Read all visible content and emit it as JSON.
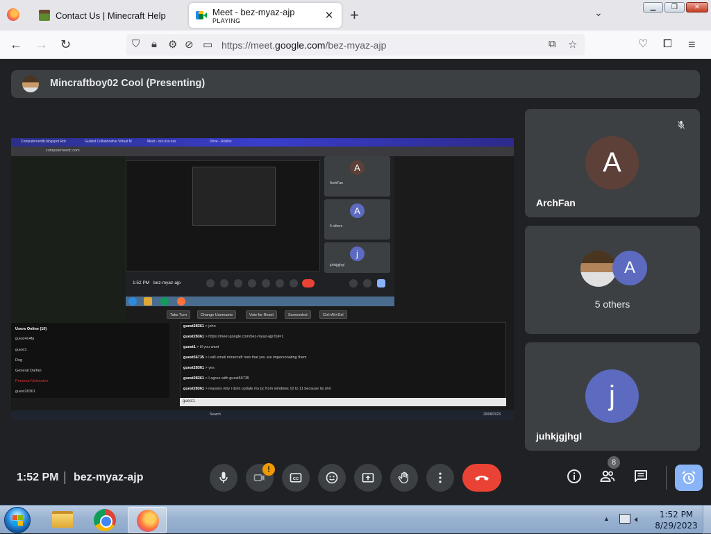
{
  "browser": {
    "tabs": [
      {
        "title": "Contact Us | Minecraft Help",
        "subtitle": ""
      },
      {
        "title": "Meet - bez-myaz-ajp",
        "subtitle": "PLAYING"
      }
    ],
    "new_tab": "+",
    "url_prefix": "https://meet.",
    "url_domain": "google.com",
    "url_suffix": "/bez-myaz-ajp"
  },
  "meet": {
    "presenter_label": "Mincraftboy02 Cool (Presenting)",
    "participants": [
      {
        "name": "ArchFan",
        "initial": "A",
        "color": "#5d4037",
        "muted": true
      },
      {
        "name": "5 others",
        "initial": "A",
        "color": "#5c6bc0"
      },
      {
        "name": "juhkjgjhgl",
        "initial": "j",
        "color": "#5c6bc0"
      }
    ],
    "time": "1:52 PM",
    "meeting_code": "bez-myaz-ajp",
    "camera_warning": "!",
    "people_count": "8",
    "shared_screen": {
      "tab_labels": [
        "Computernerdb.blogspot Rdc",
        "Guided Collaborative Virtual M",
        "Meet - xxx-xxx-xxx",
        "Drive - Roblox"
      ],
      "url": "computernerdc.com",
      "mini_tiles": [
        {
          "name": "ArchFan",
          "initial": "A",
          "color": "#5d4037"
        },
        {
          "name": "5 others",
          "initial": "A",
          "color": "#5c6bc0"
        },
        {
          "name": "juhkjgjhgl",
          "initial": "j",
          "color": "#5c6bc0"
        }
      ],
      "mini_time": "1:52 PM",
      "mini_code": "bez-myaz-ajp",
      "toolbar": [
        "Take Turn",
        "Change Username",
        "Vote for Reset",
        "Screenshot",
        "Ctrl+Alt+Del"
      ],
      "users_header": "Users Online (10)",
      "users": [
        "guest4n4fa",
        "guest1",
        "Dog",
        "General Darfan",
        "Personal Unbeaten",
        "guest28361"
      ],
      "chat": [
        {
          "user": "guest28361",
          "text": "john"
        },
        {
          "user": "guest28361",
          "text": "https://meet.google.com/bez-myaz-ajp?pli=1"
        },
        {
          "user": "guest1",
          "text": "ill you want"
        },
        {
          "user": "guest56735",
          "text": "i will email minecraft now that you are impersonating them"
        },
        {
          "user": "guest28361",
          "text": "yes"
        },
        {
          "user": "guest28361",
          "text": "I agree with guest56735"
        },
        {
          "user": "guest28361",
          "text": "reasons why i dont update my pc from windows 10 to 11 because its shit"
        }
      ],
      "chat_input": "guest1",
      "taskbar_search": "Search",
      "taskbar_date": "29/08/2023"
    }
  },
  "taskbar": {
    "time": "1:52 PM",
    "date": "8/29/2023"
  }
}
